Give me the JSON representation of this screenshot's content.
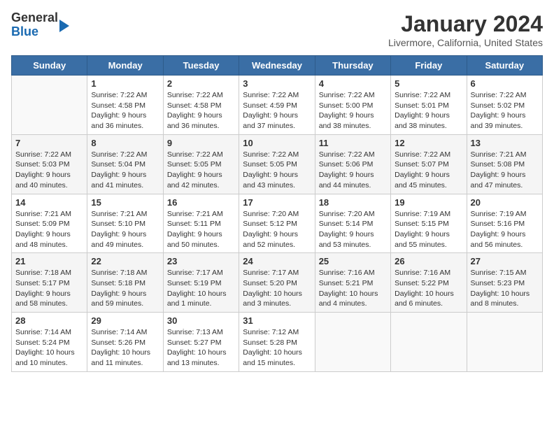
{
  "header": {
    "logo_line1": "General",
    "logo_line2": "Blue",
    "title": "January 2024",
    "subtitle": "Livermore, California, United States"
  },
  "weekdays": [
    "Sunday",
    "Monday",
    "Tuesday",
    "Wednesday",
    "Thursday",
    "Friday",
    "Saturday"
  ],
  "weeks": [
    [
      {
        "day": "",
        "info": ""
      },
      {
        "day": "1",
        "info": "Sunrise: 7:22 AM\nSunset: 4:58 PM\nDaylight: 9 hours\nand 36 minutes."
      },
      {
        "day": "2",
        "info": "Sunrise: 7:22 AM\nSunset: 4:58 PM\nDaylight: 9 hours\nand 36 minutes."
      },
      {
        "day": "3",
        "info": "Sunrise: 7:22 AM\nSunset: 4:59 PM\nDaylight: 9 hours\nand 37 minutes."
      },
      {
        "day": "4",
        "info": "Sunrise: 7:22 AM\nSunset: 5:00 PM\nDaylight: 9 hours\nand 38 minutes."
      },
      {
        "day": "5",
        "info": "Sunrise: 7:22 AM\nSunset: 5:01 PM\nDaylight: 9 hours\nand 38 minutes."
      },
      {
        "day": "6",
        "info": "Sunrise: 7:22 AM\nSunset: 5:02 PM\nDaylight: 9 hours\nand 39 minutes."
      }
    ],
    [
      {
        "day": "7",
        "info": "Sunrise: 7:22 AM\nSunset: 5:03 PM\nDaylight: 9 hours\nand 40 minutes."
      },
      {
        "day": "8",
        "info": "Sunrise: 7:22 AM\nSunset: 5:04 PM\nDaylight: 9 hours\nand 41 minutes."
      },
      {
        "day": "9",
        "info": "Sunrise: 7:22 AM\nSunset: 5:05 PM\nDaylight: 9 hours\nand 42 minutes."
      },
      {
        "day": "10",
        "info": "Sunrise: 7:22 AM\nSunset: 5:05 PM\nDaylight: 9 hours\nand 43 minutes."
      },
      {
        "day": "11",
        "info": "Sunrise: 7:22 AM\nSunset: 5:06 PM\nDaylight: 9 hours\nand 44 minutes."
      },
      {
        "day": "12",
        "info": "Sunrise: 7:22 AM\nSunset: 5:07 PM\nDaylight: 9 hours\nand 45 minutes."
      },
      {
        "day": "13",
        "info": "Sunrise: 7:21 AM\nSunset: 5:08 PM\nDaylight: 9 hours\nand 47 minutes."
      }
    ],
    [
      {
        "day": "14",
        "info": "Sunrise: 7:21 AM\nSunset: 5:09 PM\nDaylight: 9 hours\nand 48 minutes."
      },
      {
        "day": "15",
        "info": "Sunrise: 7:21 AM\nSunset: 5:10 PM\nDaylight: 9 hours\nand 49 minutes."
      },
      {
        "day": "16",
        "info": "Sunrise: 7:21 AM\nSunset: 5:11 PM\nDaylight: 9 hours\nand 50 minutes."
      },
      {
        "day": "17",
        "info": "Sunrise: 7:20 AM\nSunset: 5:12 PM\nDaylight: 9 hours\nand 52 minutes."
      },
      {
        "day": "18",
        "info": "Sunrise: 7:20 AM\nSunset: 5:14 PM\nDaylight: 9 hours\nand 53 minutes."
      },
      {
        "day": "19",
        "info": "Sunrise: 7:19 AM\nSunset: 5:15 PM\nDaylight: 9 hours\nand 55 minutes."
      },
      {
        "day": "20",
        "info": "Sunrise: 7:19 AM\nSunset: 5:16 PM\nDaylight: 9 hours\nand 56 minutes."
      }
    ],
    [
      {
        "day": "21",
        "info": "Sunrise: 7:18 AM\nSunset: 5:17 PM\nDaylight: 9 hours\nand 58 minutes."
      },
      {
        "day": "22",
        "info": "Sunrise: 7:18 AM\nSunset: 5:18 PM\nDaylight: 9 hours\nand 59 minutes."
      },
      {
        "day": "23",
        "info": "Sunrise: 7:17 AM\nSunset: 5:19 PM\nDaylight: 10 hours\nand 1 minute."
      },
      {
        "day": "24",
        "info": "Sunrise: 7:17 AM\nSunset: 5:20 PM\nDaylight: 10 hours\nand 3 minutes."
      },
      {
        "day": "25",
        "info": "Sunrise: 7:16 AM\nSunset: 5:21 PM\nDaylight: 10 hours\nand 4 minutes."
      },
      {
        "day": "26",
        "info": "Sunrise: 7:16 AM\nSunset: 5:22 PM\nDaylight: 10 hours\nand 6 minutes."
      },
      {
        "day": "27",
        "info": "Sunrise: 7:15 AM\nSunset: 5:23 PM\nDaylight: 10 hours\nand 8 minutes."
      }
    ],
    [
      {
        "day": "28",
        "info": "Sunrise: 7:14 AM\nSunset: 5:24 PM\nDaylight: 10 hours\nand 10 minutes."
      },
      {
        "day": "29",
        "info": "Sunrise: 7:14 AM\nSunset: 5:26 PM\nDaylight: 10 hours\nand 11 minutes."
      },
      {
        "day": "30",
        "info": "Sunrise: 7:13 AM\nSunset: 5:27 PM\nDaylight: 10 hours\nand 13 minutes."
      },
      {
        "day": "31",
        "info": "Sunrise: 7:12 AM\nSunset: 5:28 PM\nDaylight: 10 hours\nand 15 minutes."
      },
      {
        "day": "",
        "info": ""
      },
      {
        "day": "",
        "info": ""
      },
      {
        "day": "",
        "info": ""
      }
    ]
  ]
}
